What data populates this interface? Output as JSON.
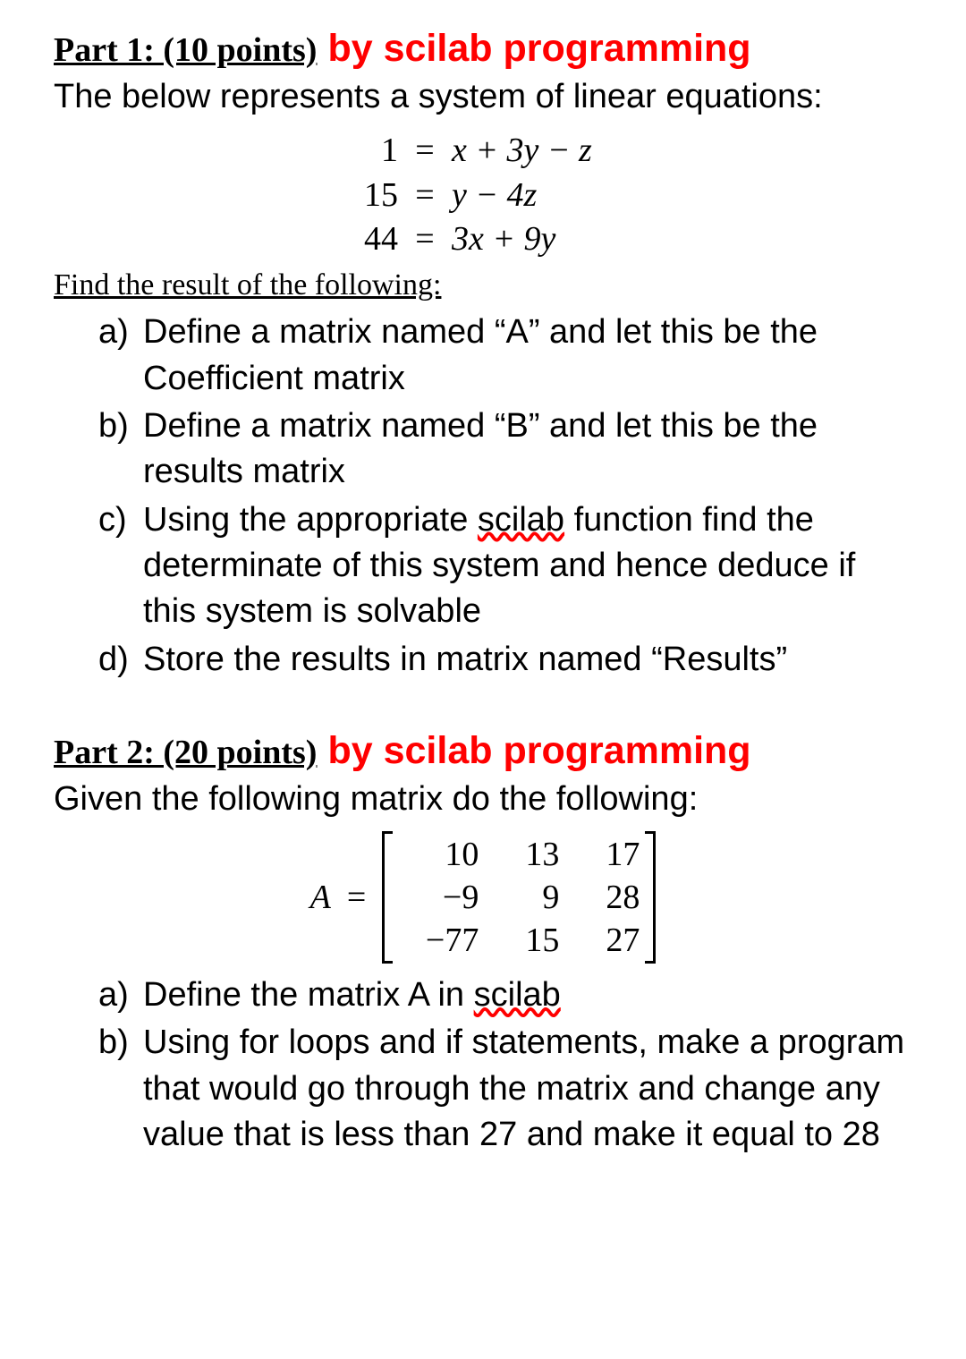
{
  "part1": {
    "label": "Part 1: (10 points)",
    "scilab": "by scilab programming",
    "intro": "The below represents a system of linear equations:",
    "equations": [
      {
        "left": "1",
        "eq": "=",
        "right_pre": "x",
        "right_post": " + 3y − z"
      },
      {
        "left": "15",
        "eq": "=",
        "right_pre": "y",
        "right_post": " − 4z"
      },
      {
        "left": "44",
        "eq": "=",
        "right_pre": "3x",
        "right_post": " + 9y"
      }
    ],
    "find": "Find the result of the following:",
    "items": [
      {
        "marker": "a)",
        "text_before": "Define a matrix named “A” and let this be the Coefficient matrix",
        "squiggle": "",
        "text_after": ""
      },
      {
        "marker": "b)",
        "text_before": "Define a matrix named “B” and let this be the results matrix",
        "squiggle": "",
        "text_after": ""
      },
      {
        "marker": "c)",
        "text_before": "Using the appropriate ",
        "squiggle": "scilab",
        "text_after": " function find the determinate of this system and hence deduce if this system is solvable"
      },
      {
        "marker": "d)",
        "text_before": "Store the results in matrix named “Results”",
        "squiggle": "",
        "text_after": ""
      }
    ]
  },
  "part2": {
    "label": "Part 2: (20 points)",
    "scilab": "by scilab programming",
    "intro": "Given the following matrix do the following:",
    "matrix": {
      "name": "A",
      "eq": "=",
      "rows": [
        [
          "10",
          "13",
          "17"
        ],
        [
          "−9",
          "9",
          "28"
        ],
        [
          "−77",
          "15",
          "27"
        ]
      ]
    },
    "items": [
      {
        "marker": "a)",
        "text_before": "Define the matrix A in ",
        "squiggle": "scilab",
        "text_after": ""
      },
      {
        "marker": "b)",
        "text_before": "Using for loops and if statements, make a program that would go through the matrix and change any value that is less than 27 and make it equal to 28",
        "squiggle": "",
        "text_after": ""
      }
    ]
  }
}
